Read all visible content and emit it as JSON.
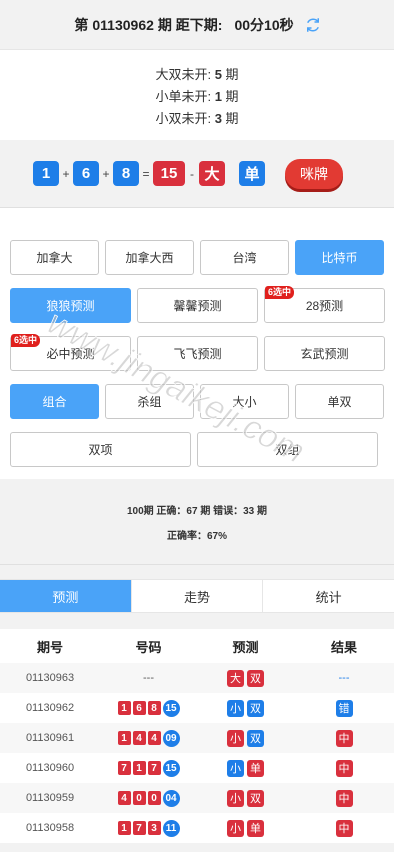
{
  "header": {
    "prefix": "第",
    "issue": "01130962",
    "suffix": "期 距下期:",
    "countdown": "00分10秒",
    "refresh_icon": "refresh-icon"
  },
  "missing": [
    {
      "label": "大双未开:",
      "count": "5",
      "unit": "期"
    },
    {
      "label": "小单未开:",
      "count": "1",
      "unit": "期"
    },
    {
      "label": "小双未开:",
      "count": "3",
      "unit": "期"
    }
  ],
  "result": {
    "n1": "1",
    "plus1": "+",
    "n2": "6",
    "plus2": "+",
    "n3": "8",
    "eq": "=",
    "sum": "15",
    "dash": "-",
    "size": "大",
    "parity": "单",
    "mipai": "咪牌"
  },
  "lottery_buttons": [
    "加拿大",
    "加拿大西",
    "台湾",
    "比特币"
  ],
  "predictor_row1": [
    "狼狼预测",
    "馨馨预测",
    "28预测"
  ],
  "predictor_row2": [
    "必中预测",
    "飞飞预测",
    "玄武预测"
  ],
  "badge_text": "6选中",
  "type_row1": [
    "组合",
    "杀组",
    "大小",
    "单双"
  ],
  "type_row2": [
    "双项",
    "双组"
  ],
  "accuracy": {
    "line1": "100期 正确：67 期 错误：33 期",
    "line2": "正确率：67%"
  },
  "tabs": [
    "预测",
    "走势",
    "统计"
  ],
  "table": {
    "headers": [
      "期号",
      "号码",
      "预测",
      "结果"
    ],
    "rows": [
      {
        "issue": "01130963",
        "nums": [
          "---"
        ],
        "pred": [
          "大",
          "双"
        ],
        "pred_color": "red",
        "result": "---"
      },
      {
        "issue": "01130962",
        "nums": [
          "1",
          "6",
          "8",
          "15"
        ],
        "pred": [
          "小",
          "双"
        ],
        "pred_color": "blue",
        "result": "错"
      },
      {
        "issue": "01130961",
        "nums": [
          "1",
          "4",
          "4",
          "09"
        ],
        "pred": [
          "小",
          "双"
        ],
        "pred_color": "mixed",
        "result": "中"
      },
      {
        "issue": "01130960",
        "nums": [
          "7",
          "1",
          "7",
          "15"
        ],
        "pred": [
          "小",
          "单"
        ],
        "pred_color": "mixed",
        "result": "中"
      },
      {
        "issue": "01130959",
        "nums": [
          "4",
          "0",
          "0",
          "04"
        ],
        "pred": [
          "小",
          "双"
        ],
        "pred_color": "red",
        "result": "中"
      },
      {
        "issue": "01130958",
        "nums": [
          "1",
          "7",
          "3",
          "11"
        ],
        "pred": [
          "小",
          "单"
        ],
        "pred_color": "red",
        "result": "中"
      }
    ]
  },
  "watermark": "www.jingaikeji.com",
  "colors": {
    "accent": "#4aa3f8",
    "red": "#d9303d",
    "blue": "#1e7ee8"
  }
}
